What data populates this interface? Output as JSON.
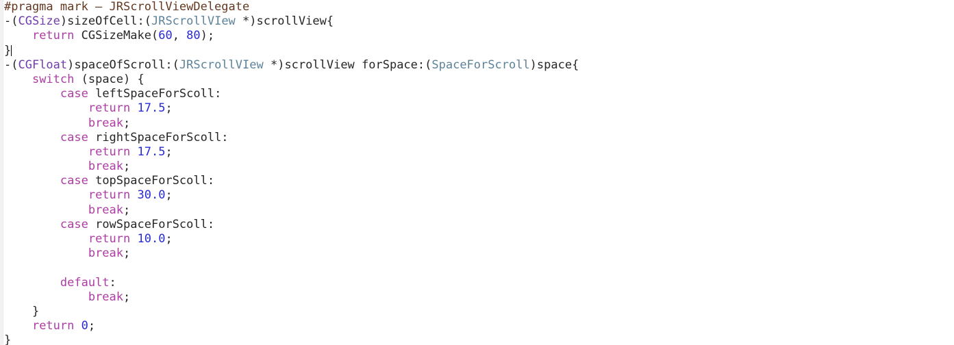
{
  "editor": {
    "language": "Objective-C",
    "background_color": "#ffffff",
    "caret_line_index": 3,
    "theme": {
      "plain_text": "#262626",
      "preprocessor": "#643820",
      "system_type": "#703daa",
      "project_class": "#5c8299",
      "keyword": "#ad3da4",
      "number": "#272ad8",
      "caret": "#000000",
      "gutter": "#f2f2f2"
    },
    "lines": [
      {
        "index": 0,
        "text": "#pragma mark — JRScrollViewDelegate",
        "tokens": [
          {
            "t": "#pragma mark — JRScrollViewDelegate",
            "c": "t-pre"
          }
        ]
      },
      {
        "index": 1,
        "text": "-(CGSize)sizeOfCell:(JRScrollVIew *)scrollView{",
        "tokens": [
          {
            "t": "-(",
            "c": "t-plain"
          },
          {
            "t": "CGSize",
            "c": "t-type"
          },
          {
            "t": ")sizeOfCell:(",
            "c": "t-plain"
          },
          {
            "t": "JRScrollVIew",
            "c": "t-class"
          },
          {
            "t": " *)scrollView{",
            "c": "t-plain"
          }
        ]
      },
      {
        "index": 2,
        "text": "    return CGSizeMake(60, 80);",
        "tokens": [
          {
            "t": "    ",
            "c": "t-plain"
          },
          {
            "t": "return",
            "c": "t-kw"
          },
          {
            "t": " CGSizeMake(",
            "c": "t-plain"
          },
          {
            "t": "60",
            "c": "t-num"
          },
          {
            "t": ", ",
            "c": "t-plain"
          },
          {
            "t": "80",
            "c": "t-num"
          },
          {
            "t": ");",
            "c": "t-plain"
          }
        ]
      },
      {
        "index": 3,
        "text": "}",
        "tokens": [
          {
            "t": "}",
            "c": "t-plain"
          }
        ]
      },
      {
        "index": 4,
        "text": "-(CGFloat)spaceOfScroll:(JRScrollVIew *)scrollView forSpace:(SpaceForScroll)space{",
        "tokens": [
          {
            "t": "-(",
            "c": "t-plain"
          },
          {
            "t": "CGFloat",
            "c": "t-type"
          },
          {
            "t": ")spaceOfScroll:(",
            "c": "t-plain"
          },
          {
            "t": "JRScrollVIew",
            "c": "t-class"
          },
          {
            "t": " *)scrollView forSpace:(",
            "c": "t-plain"
          },
          {
            "t": "SpaceForScroll",
            "c": "t-class"
          },
          {
            "t": ")space{",
            "c": "t-plain"
          }
        ]
      },
      {
        "index": 5,
        "text": "    switch (space) {",
        "tokens": [
          {
            "t": "    ",
            "c": "t-plain"
          },
          {
            "t": "switch",
            "c": "t-kw"
          },
          {
            "t": " (space) {",
            "c": "t-plain"
          }
        ]
      },
      {
        "index": 6,
        "text": "        case leftSpaceForScoll:",
        "tokens": [
          {
            "t": "        ",
            "c": "t-plain"
          },
          {
            "t": "case",
            "c": "t-kw"
          },
          {
            "t": " leftSpaceForScoll:",
            "c": "t-ident"
          }
        ]
      },
      {
        "index": 7,
        "text": "            return 17.5;",
        "tokens": [
          {
            "t": "            ",
            "c": "t-plain"
          },
          {
            "t": "return",
            "c": "t-kw"
          },
          {
            "t": " ",
            "c": "t-plain"
          },
          {
            "t": "17.5",
            "c": "t-num"
          },
          {
            "t": ";",
            "c": "t-plain"
          }
        ]
      },
      {
        "index": 8,
        "text": "            break;",
        "tokens": [
          {
            "t": "            ",
            "c": "t-plain"
          },
          {
            "t": "break",
            "c": "t-kw"
          },
          {
            "t": ";",
            "c": "t-plain"
          }
        ]
      },
      {
        "index": 9,
        "text": "        case rightSpaceForScoll:",
        "tokens": [
          {
            "t": "        ",
            "c": "t-plain"
          },
          {
            "t": "case",
            "c": "t-kw"
          },
          {
            "t": " rightSpaceForScoll:",
            "c": "t-ident"
          }
        ]
      },
      {
        "index": 10,
        "text": "            return 17.5;",
        "tokens": [
          {
            "t": "            ",
            "c": "t-plain"
          },
          {
            "t": "return",
            "c": "t-kw"
          },
          {
            "t": " ",
            "c": "t-plain"
          },
          {
            "t": "17.5",
            "c": "t-num"
          },
          {
            "t": ";",
            "c": "t-plain"
          }
        ]
      },
      {
        "index": 11,
        "text": "            break;",
        "tokens": [
          {
            "t": "            ",
            "c": "t-plain"
          },
          {
            "t": "break",
            "c": "t-kw"
          },
          {
            "t": ";",
            "c": "t-plain"
          }
        ]
      },
      {
        "index": 12,
        "text": "        case topSpaceForScoll:",
        "tokens": [
          {
            "t": "        ",
            "c": "t-plain"
          },
          {
            "t": "case",
            "c": "t-kw"
          },
          {
            "t": " topSpaceForScoll:",
            "c": "t-ident"
          }
        ]
      },
      {
        "index": 13,
        "text": "            return 30.0;",
        "tokens": [
          {
            "t": "            ",
            "c": "t-plain"
          },
          {
            "t": "return",
            "c": "t-kw"
          },
          {
            "t": " ",
            "c": "t-plain"
          },
          {
            "t": "30.0",
            "c": "t-num"
          },
          {
            "t": ";",
            "c": "t-plain"
          }
        ]
      },
      {
        "index": 14,
        "text": "            break;",
        "tokens": [
          {
            "t": "            ",
            "c": "t-plain"
          },
          {
            "t": "break",
            "c": "t-kw"
          },
          {
            "t": ";",
            "c": "t-plain"
          }
        ]
      },
      {
        "index": 15,
        "text": "        case rowSpaceForScoll:",
        "tokens": [
          {
            "t": "        ",
            "c": "t-plain"
          },
          {
            "t": "case",
            "c": "t-kw"
          },
          {
            "t": " rowSpaceForScoll:",
            "c": "t-ident"
          }
        ]
      },
      {
        "index": 16,
        "text": "            return 10.0;",
        "tokens": [
          {
            "t": "            ",
            "c": "t-plain"
          },
          {
            "t": "return",
            "c": "t-kw"
          },
          {
            "t": " ",
            "c": "t-plain"
          },
          {
            "t": "10.0",
            "c": "t-num"
          },
          {
            "t": ";",
            "c": "t-plain"
          }
        ]
      },
      {
        "index": 17,
        "text": "            break;",
        "tokens": [
          {
            "t": "            ",
            "c": "t-plain"
          },
          {
            "t": "break",
            "c": "t-kw"
          },
          {
            "t": ";",
            "c": "t-plain"
          }
        ]
      },
      {
        "index": 18,
        "text": "",
        "tokens": []
      },
      {
        "index": 19,
        "text": "        default:",
        "tokens": [
          {
            "t": "        ",
            "c": "t-plain"
          },
          {
            "t": "default",
            "c": "t-kw"
          },
          {
            "t": ":",
            "c": "t-plain"
          }
        ]
      },
      {
        "index": 20,
        "text": "            break;",
        "tokens": [
          {
            "t": "            ",
            "c": "t-plain"
          },
          {
            "t": "break",
            "c": "t-kw"
          },
          {
            "t": ";",
            "c": "t-plain"
          }
        ]
      },
      {
        "index": 21,
        "text": "    }",
        "tokens": [
          {
            "t": "    }",
            "c": "t-plain"
          }
        ]
      },
      {
        "index": 22,
        "text": "    return 0;",
        "tokens": [
          {
            "t": "    ",
            "c": "t-plain"
          },
          {
            "t": "return",
            "c": "t-kw"
          },
          {
            "t": " ",
            "c": "t-plain"
          },
          {
            "t": "0",
            "c": "t-num"
          },
          {
            "t": ";",
            "c": "t-plain"
          }
        ]
      },
      {
        "index": 23,
        "text": "}",
        "tokens": [
          {
            "t": "}",
            "c": "t-plain"
          }
        ]
      }
    ]
  }
}
